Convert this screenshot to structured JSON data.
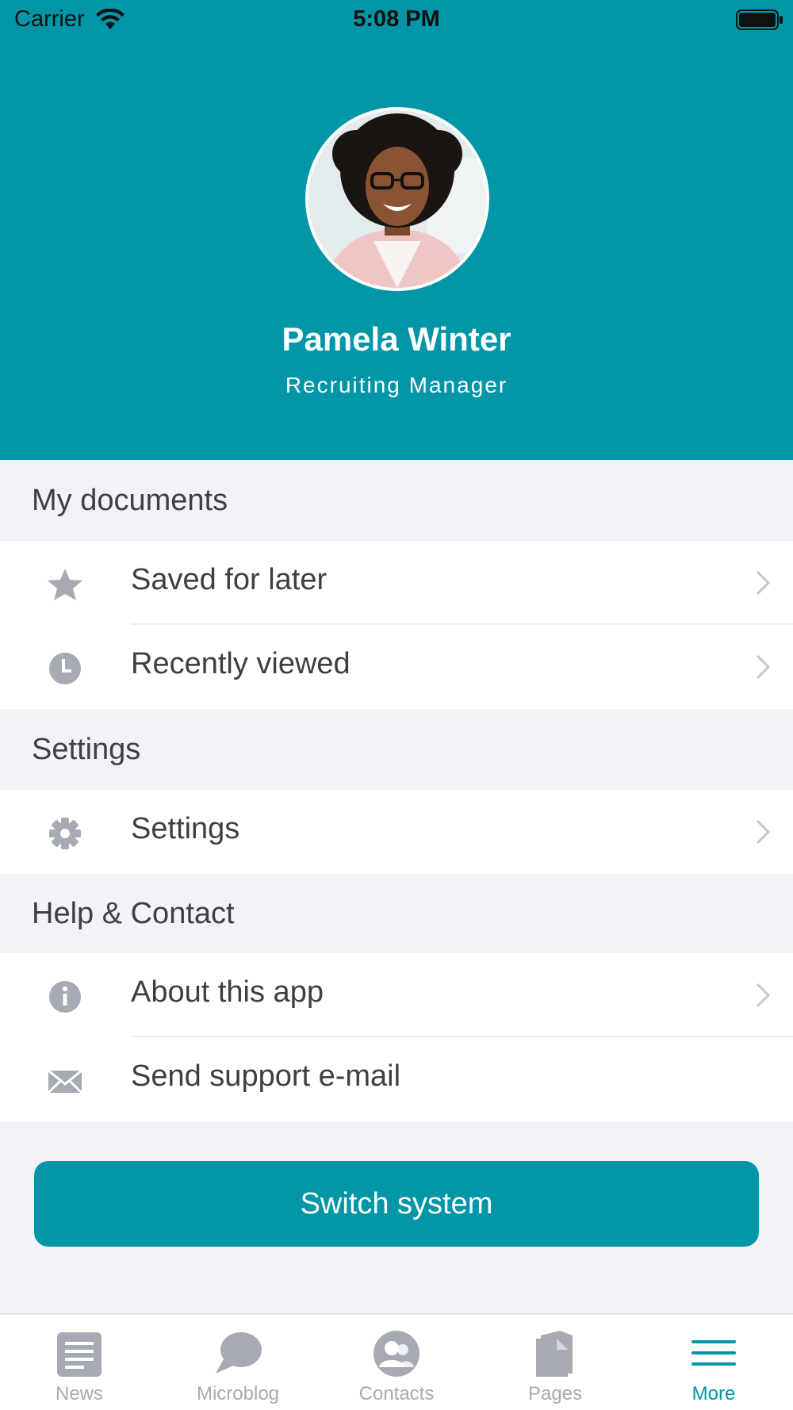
{
  "status_bar": {
    "carrier": "Carrier",
    "time": "5:08 PM"
  },
  "profile": {
    "name": "Pamela Winter",
    "title": "Recruiting Manager"
  },
  "sections": {
    "documents": {
      "header": "My documents",
      "items": [
        {
          "label": "Saved for later",
          "icon": "star-icon"
        },
        {
          "label": "Recently viewed",
          "icon": "clock-icon"
        }
      ]
    },
    "settings": {
      "header": "Settings",
      "items": [
        {
          "label": "Settings",
          "icon": "gear-icon"
        }
      ]
    },
    "help": {
      "header": "Help & Contact",
      "items": [
        {
          "label": "About this app",
          "icon": "info-icon"
        },
        {
          "label": "Send support e-mail",
          "icon": "mail-icon"
        }
      ]
    }
  },
  "switch_button": {
    "label": "Switch system"
  },
  "tab_bar": {
    "tabs": [
      {
        "label": "News",
        "icon": "news-icon"
      },
      {
        "label": "Microblog",
        "icon": "chat-bubble-icon"
      },
      {
        "label": "Contacts",
        "icon": "contacts-icon"
      },
      {
        "label": "Pages",
        "icon": "pages-icon"
      },
      {
        "label": "More",
        "icon": "menu-icon"
      }
    ],
    "active": "More"
  },
  "colors": {
    "accent": "#0096a8",
    "background": "#f2f3f7",
    "icon_gray": "#a7a9b3",
    "text": "#3e3e44"
  }
}
